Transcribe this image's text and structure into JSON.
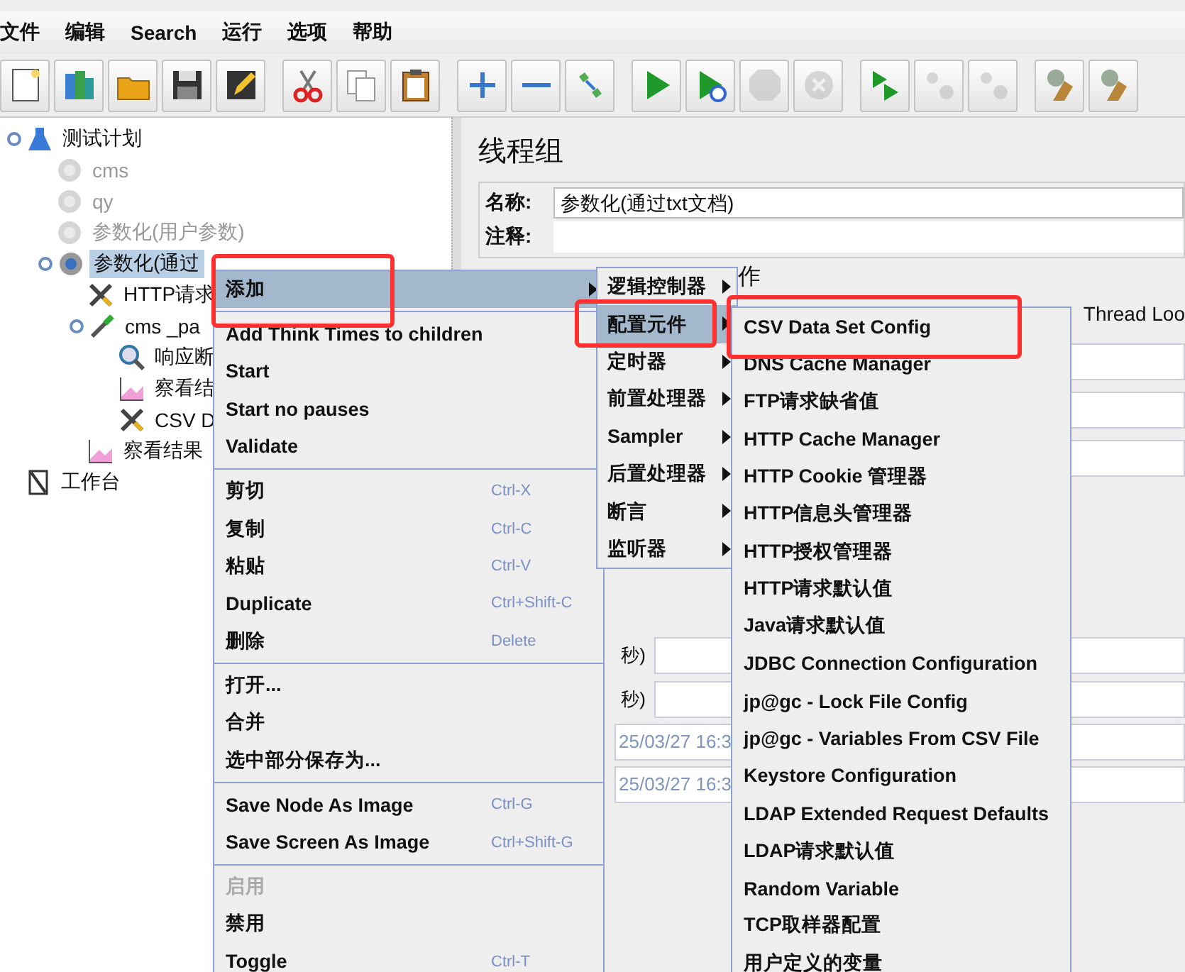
{
  "menu_bar": [
    "文件",
    "编辑",
    "Search",
    "运行",
    "选项",
    "帮助"
  ],
  "toolbar": [
    [
      {
        "kind": "new",
        "disabled": false
      },
      {
        "kind": "templates",
        "disabled": false
      },
      {
        "kind": "open",
        "disabled": false
      },
      {
        "kind": "save",
        "disabled": false
      },
      {
        "kind": "save-as",
        "disabled": false
      }
    ],
    [
      {
        "kind": "cut",
        "disabled": false
      },
      {
        "kind": "copy",
        "disabled": false
      },
      {
        "kind": "paste",
        "disabled": false
      }
    ],
    [
      {
        "kind": "expand",
        "disabled": false
      },
      {
        "kind": "collapse",
        "disabled": false
      },
      {
        "kind": "toggle",
        "disabled": false
      }
    ],
    [
      {
        "kind": "start",
        "disabled": false
      },
      {
        "kind": "start-no-timers",
        "disabled": false
      },
      {
        "kind": "stop",
        "disabled": true
      },
      {
        "kind": "shutdown",
        "disabled": true
      }
    ],
    [
      {
        "kind": "remote-start",
        "disabled": false
      },
      {
        "kind": "remote-stop",
        "disabled": true
      },
      {
        "kind": "remote-shutdown",
        "disabled": true
      }
    ],
    [
      {
        "kind": "clear",
        "disabled": false
      },
      {
        "kind": "clear-all",
        "disabled": false
      }
    ]
  ],
  "tree": [
    {
      "label": "测试计划",
      "kind": "flask",
      "disabled": false,
      "selected": false,
      "children": [
        {
          "label": "cms",
          "kind": "gear",
          "disabled": true,
          "selected": false
        },
        {
          "label": "qy",
          "kind": "gear",
          "disabled": true,
          "selected": false
        },
        {
          "label": "参数化(用户参数)",
          "kind": "gear",
          "disabled": true,
          "selected": false
        },
        {
          "label": "参数化(通过",
          "kind": "gear",
          "disabled": false,
          "selected": true,
          "children": [
            {
              "label": "HTTP请求",
              "kind": "wrench",
              "disabled": false,
              "selected": false
            },
            {
              "label": "cms _pa",
              "kind": "dropper",
              "disabled": false,
              "selected": false,
              "children": [
                {
                  "label": "响应断",
                  "kind": "magnifier",
                  "disabled": false,
                  "selected": false
                },
                {
                  "label": "察看结",
                  "kind": "chart",
                  "disabled": false,
                  "selected": false
                },
                {
                  "label": "CSV D",
                  "kind": "wrench",
                  "disabled": false,
                  "selected": false
                }
              ]
            },
            {
              "label": "察看结果",
              "kind": "chart",
              "disabled": false,
              "selected": false
            }
          ]
        }
      ]
    },
    {
      "label": "工作台",
      "kind": "workbench",
      "disabled": false,
      "selected": false
    }
  ],
  "panel": {
    "title": "线程组",
    "name_label": "名称:",
    "name_value": "参数化(通过txt文档)",
    "comment_label": "注释:",
    "section_title": "作",
    "loop_text": "Thread Loo",
    "delay_labels": [
      "秒)",
      "秒)"
    ],
    "times": [
      "25/03/27 16:3",
      "25/03/27 16:3"
    ]
  },
  "menus": [
    {
      "items": [
        {
          "kind": "item",
          "label": "添加",
          "submenu": true,
          "selected": true,
          "disabled": false,
          "annotated": true
        },
        {
          "kind": "separator"
        },
        {
          "kind": "item",
          "label": "Add Think Times to children",
          "submenu": false,
          "selected": false,
          "disabled": false,
          "annotated": false
        },
        {
          "kind": "item",
          "label": "Start",
          "submenu": false,
          "selected": false,
          "disabled": false,
          "annotated": false
        },
        {
          "kind": "item",
          "label": "Start no pauses",
          "submenu": false,
          "selected": false,
          "disabled": false,
          "annotated": false
        },
        {
          "kind": "item",
          "label": "Validate",
          "submenu": false,
          "selected": false,
          "disabled": false,
          "annotated": false
        },
        {
          "kind": "separator"
        },
        {
          "kind": "item",
          "label": "剪切",
          "shortcut": "Ctrl-X",
          "submenu": false,
          "selected": false,
          "disabled": false,
          "annotated": false
        },
        {
          "kind": "item",
          "label": "复制",
          "shortcut": "Ctrl-C",
          "submenu": false,
          "selected": false,
          "disabled": false,
          "annotated": false
        },
        {
          "kind": "item",
          "label": "粘贴",
          "shortcut": "Ctrl-V",
          "submenu": false,
          "selected": false,
          "disabled": false,
          "annotated": false
        },
        {
          "kind": "item",
          "label": "Duplicate",
          "shortcut": "Ctrl+Shift-C",
          "submenu": false,
          "selected": false,
          "disabled": false,
          "annotated": false
        },
        {
          "kind": "item",
          "label": "删除",
          "shortcut": "Delete",
          "submenu": false,
          "selected": false,
          "disabled": false,
          "annotated": false
        },
        {
          "kind": "separator"
        },
        {
          "kind": "item",
          "label": "打开...",
          "submenu": false,
          "selected": false,
          "disabled": false,
          "annotated": false
        },
        {
          "kind": "item",
          "label": "合并",
          "submenu": false,
          "selected": false,
          "disabled": false,
          "annotated": false
        },
        {
          "kind": "item",
          "label": "选中部分保存为...",
          "submenu": false,
          "selected": false,
          "disabled": false,
          "annotated": false
        },
        {
          "kind": "separator"
        },
        {
          "kind": "item",
          "label": "Save Node As Image",
          "shortcut": "Ctrl-G",
          "submenu": false,
          "selected": false,
          "disabled": false,
          "annotated": false
        },
        {
          "kind": "item",
          "label": "Save Screen As Image",
          "shortcut": "Ctrl+Shift-G",
          "submenu": false,
          "selected": false,
          "disabled": false,
          "annotated": false
        },
        {
          "kind": "separator"
        },
        {
          "kind": "item",
          "label": "启用",
          "submenu": false,
          "selected": false,
          "disabled": true,
          "annotated": false
        },
        {
          "kind": "item",
          "label": "禁用",
          "submenu": false,
          "selected": false,
          "disabled": false,
          "annotated": false
        },
        {
          "kind": "item",
          "label": "Toggle",
          "shortcut": "Ctrl-T",
          "submenu": false,
          "selected": false,
          "disabled": false,
          "annotated": false
        }
      ]
    },
    {
      "items": [
        {
          "kind": "item",
          "label": "逻辑控制器",
          "submenu": true,
          "selected": false,
          "disabled": false,
          "annotated": false
        },
        {
          "kind": "item",
          "label": "配置元件",
          "submenu": true,
          "selected": true,
          "disabled": false,
          "annotated": true
        },
        {
          "kind": "item",
          "label": "定时器",
          "submenu": true,
          "selected": false,
          "disabled": false,
          "annotated": false
        },
        {
          "kind": "item",
          "label": "前置处理器",
          "submenu": true,
          "selected": false,
          "disabled": false,
          "annotated": false
        },
        {
          "kind": "item",
          "label": "Sampler",
          "submenu": true,
          "selected": false,
          "disabled": false,
          "annotated": false
        },
        {
          "kind": "item",
          "label": "后置处理器",
          "submenu": true,
          "selected": false,
          "disabled": false,
          "annotated": false
        },
        {
          "kind": "item",
          "label": "断言",
          "submenu": true,
          "selected": false,
          "disabled": false,
          "annotated": false
        },
        {
          "kind": "item",
          "label": "监听器",
          "submenu": true,
          "selected": false,
          "disabled": false,
          "annotated": false
        }
      ]
    },
    {
      "items": [
        {
          "kind": "item",
          "label": "CSV Data Set Config",
          "submenu": false,
          "selected": false,
          "disabled": false,
          "annotated": true
        },
        {
          "kind": "item",
          "label": "DNS Cache Manager",
          "submenu": false,
          "selected": false,
          "disabled": false,
          "annotated": false
        },
        {
          "kind": "item",
          "label": "FTP请求缺省值",
          "submenu": false,
          "selected": false,
          "disabled": false,
          "annotated": false
        },
        {
          "kind": "item",
          "label": "HTTP Cache Manager",
          "submenu": false,
          "selected": false,
          "disabled": false,
          "annotated": false
        },
        {
          "kind": "item",
          "label": "HTTP Cookie 管理器",
          "submenu": false,
          "selected": false,
          "disabled": false,
          "annotated": false
        },
        {
          "kind": "item",
          "label": "HTTP信息头管理器",
          "submenu": false,
          "selected": false,
          "disabled": false,
          "annotated": false
        },
        {
          "kind": "item",
          "label": "HTTP授权管理器",
          "submenu": false,
          "selected": false,
          "disabled": false,
          "annotated": false
        },
        {
          "kind": "item",
          "label": "HTTP请求默认值",
          "submenu": false,
          "selected": false,
          "disabled": false,
          "annotated": false
        },
        {
          "kind": "item",
          "label": "Java请求默认值",
          "submenu": false,
          "selected": false,
          "disabled": false,
          "annotated": false
        },
        {
          "kind": "item",
          "label": "JDBC Connection Configuration",
          "submenu": false,
          "selected": false,
          "disabled": false,
          "annotated": false
        },
        {
          "kind": "item",
          "label": "jp@gc - Lock File Config",
          "submenu": false,
          "selected": false,
          "disabled": false,
          "annotated": false
        },
        {
          "kind": "item",
          "label": "jp@gc - Variables From CSV File",
          "submenu": false,
          "selected": false,
          "disabled": false,
          "annotated": false
        },
        {
          "kind": "item",
          "label": "Keystore Configuration",
          "submenu": false,
          "selected": false,
          "disabled": false,
          "annotated": false
        },
        {
          "kind": "item",
          "label": "LDAP Extended Request Defaults",
          "submenu": false,
          "selected": false,
          "disabled": false,
          "annotated": false
        },
        {
          "kind": "item",
          "label": "LDAP请求默认值",
          "submenu": false,
          "selected": false,
          "disabled": false,
          "annotated": false
        },
        {
          "kind": "item",
          "label": "Random Variable",
          "submenu": false,
          "selected": false,
          "disabled": false,
          "annotated": false
        },
        {
          "kind": "item",
          "label": "TCP取样器配置",
          "submenu": false,
          "selected": false,
          "disabled": false,
          "annotated": false
        },
        {
          "kind": "item",
          "label": "用户定义的变量",
          "submenu": false,
          "selected": false,
          "disabled": false,
          "annotated": false
        }
      ]
    }
  ]
}
